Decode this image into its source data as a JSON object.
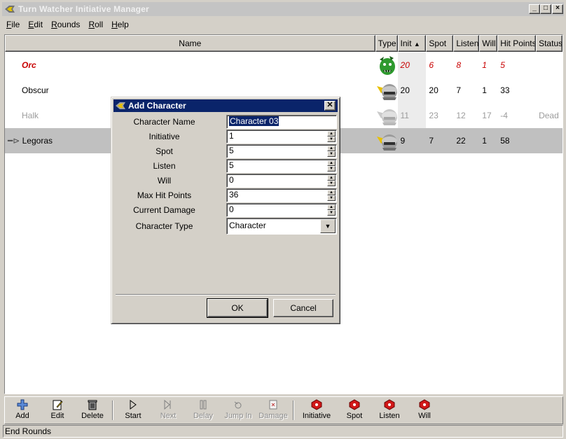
{
  "window": {
    "title": "Turn Watcher Initiative Manager"
  },
  "menu": [
    "File",
    "Edit",
    "Rounds",
    "Roll",
    "Help"
  ],
  "columns": {
    "name": "Name",
    "type": "Type",
    "init": "Init",
    "spot": "Spot",
    "listen": "Listen",
    "will": "Will",
    "hp": "Hit Points",
    "status": "Status"
  },
  "rows": [
    {
      "name": "Orc",
      "type_icon": "monster-icon",
      "init": "20",
      "spot": "6",
      "listen": "8",
      "will": "1",
      "hp": "5",
      "status": ""
    },
    {
      "name": "Obscur",
      "type_icon": "helmet-icon",
      "init": "20",
      "spot": "20",
      "listen": "7",
      "will": "1",
      "hp": "33",
      "status": ""
    },
    {
      "name": "Halk",
      "type_icon": "helmet-icon",
      "init": "11",
      "spot": "23",
      "listen": "12",
      "will": "17",
      "hp": "-4",
      "status": "Dead"
    },
    {
      "name": "Legoras",
      "type_icon": "helmet-icon",
      "init": "9",
      "spot": "7",
      "listen": "22",
      "will": "1",
      "hp": "58",
      "status": ""
    }
  ],
  "toolbar": [
    {
      "label": "Add",
      "icon": "plus-icon",
      "enabled": true
    },
    {
      "label": "Edit",
      "icon": "edit-icon",
      "enabled": true
    },
    {
      "label": "Delete",
      "icon": "trash-icon",
      "enabled": true
    },
    {
      "label": "Start",
      "icon": "play-icon",
      "enabled": true
    },
    {
      "label": "Next",
      "icon": "next-icon",
      "enabled": false
    },
    {
      "label": "Delay",
      "icon": "pause-icon",
      "enabled": false
    },
    {
      "label": "Jump In",
      "icon": "jump-icon",
      "enabled": false
    },
    {
      "label": "Damage",
      "icon": "damage-icon",
      "enabled": false
    },
    {
      "label": "Initiative",
      "icon": "die-icon",
      "enabled": true
    },
    {
      "label": "Spot",
      "icon": "die-icon",
      "enabled": true
    },
    {
      "label": "Listen",
      "icon": "die-icon",
      "enabled": true
    },
    {
      "label": "Will",
      "icon": "die-icon",
      "enabled": true
    }
  ],
  "status": "End Rounds",
  "dialog": {
    "title": "Add Character",
    "fields": {
      "name": {
        "label": "Character Name",
        "value": "Character 03"
      },
      "initiative": {
        "label": "Initiative",
        "value": "1"
      },
      "spot": {
        "label": "Spot",
        "value": "5"
      },
      "listen": {
        "label": "Listen",
        "value": "5"
      },
      "will": {
        "label": "Will",
        "value": "0"
      },
      "max_hp": {
        "label": "Max Hit Points",
        "value": "36"
      },
      "damage": {
        "label": "Current Damage",
        "value": "0"
      },
      "char_type": {
        "label": "Character Type",
        "value": "Character"
      }
    },
    "ok": "OK",
    "cancel": "Cancel"
  },
  "colors": {
    "enemy": "#c80000",
    "dead": "#9c9c9c",
    "dialog_title": "#0a246a",
    "selection": "#c0c0c0"
  }
}
